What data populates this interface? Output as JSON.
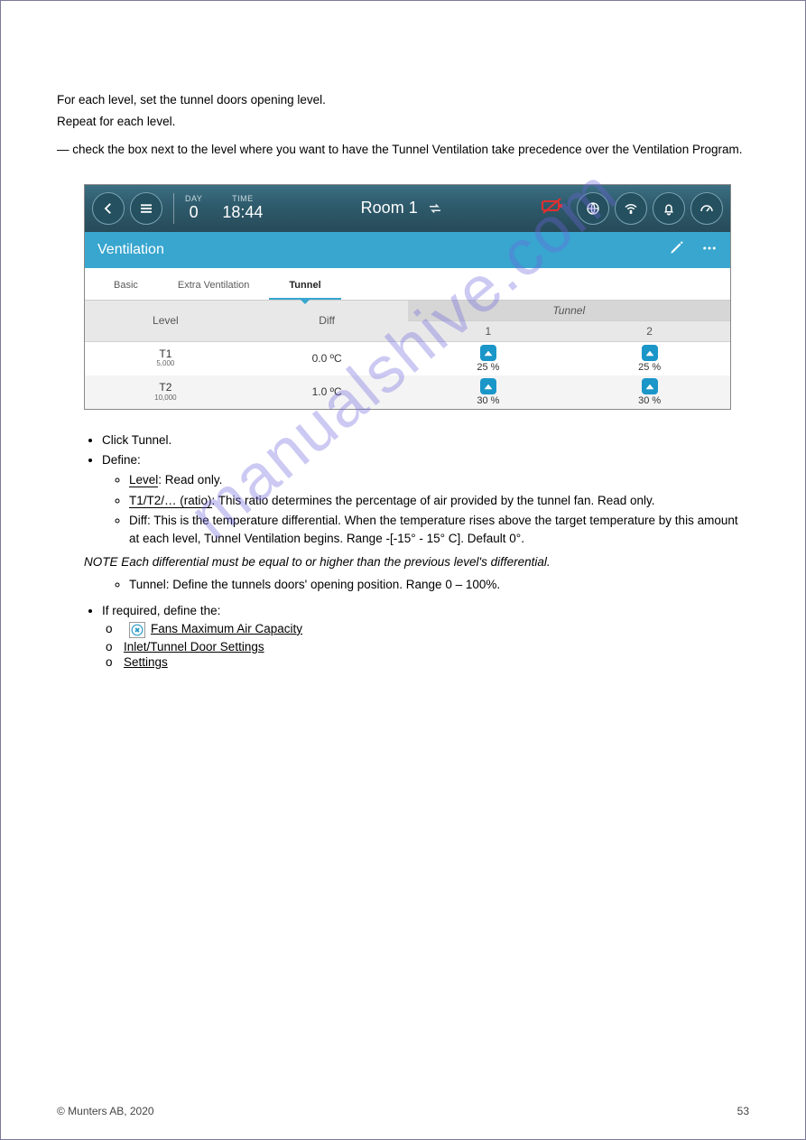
{
  "intro": {
    "p1": "For each level, set the tunnel doors opening level.",
    "p2": "Repeat for each level.",
    "check_note": "— check the box next to the level where you want to have the Tunnel Ventilation take precedence over the Ventilation Program."
  },
  "header": {
    "day_label": "DAY",
    "day_value": "0",
    "time_label": "TIME",
    "time_value": "18:44",
    "room": "Room 1"
  },
  "section_title": "Ventilation",
  "tabs": {
    "basic": "Basic",
    "extra": "Extra Ventilation",
    "tunnel": "Tunnel"
  },
  "table": {
    "col_level": "Level",
    "col_diff": "Diff",
    "col_tunnel": "Tunnel",
    "col_t1": "1",
    "col_t2": "2",
    "rows": [
      {
        "level": "T1",
        "sub": "5,000",
        "diff": "0.0 ºC",
        "v1": "25 %",
        "v2": "25 %"
      },
      {
        "level": "T2",
        "sub": "10,000",
        "diff": "1.0 ºC",
        "v1": "30 %",
        "v2": "30 %"
      }
    ]
  },
  "bullets": {
    "b0": "Click Tunnel.",
    "b1": "Define:",
    "b1a_label": "Level",
    "b1a_text": ": Read only.",
    "b1b_label": "T1/T2/… (ratio)",
    "b1b_text": ": This ratio determines the percentage of air provided by the tunnel fan. Read only.",
    "b2": "Diff: This is the temperature differential. When the temperature rises above the target temperature by this amount at each level, Tunnel Ventilation begins. Range -[-15° - 15° C]. Default 0°.",
    "b2_note": "NOTE Each differential must be equal to or higher than the previous level's differential.",
    "b3": "Tunnel: Define the tunnels doors' opening position. Range 0 – 100%.",
    "def_heading": "If required, define the:",
    "fan_cap": "Fans Maximum Air Capacity",
    "inlet_door": "Inlet/Tunnel Door Settings",
    "settings": "Settings"
  },
  "footer": {
    "copyright": "© Munters AB, 2020",
    "page": "53"
  }
}
